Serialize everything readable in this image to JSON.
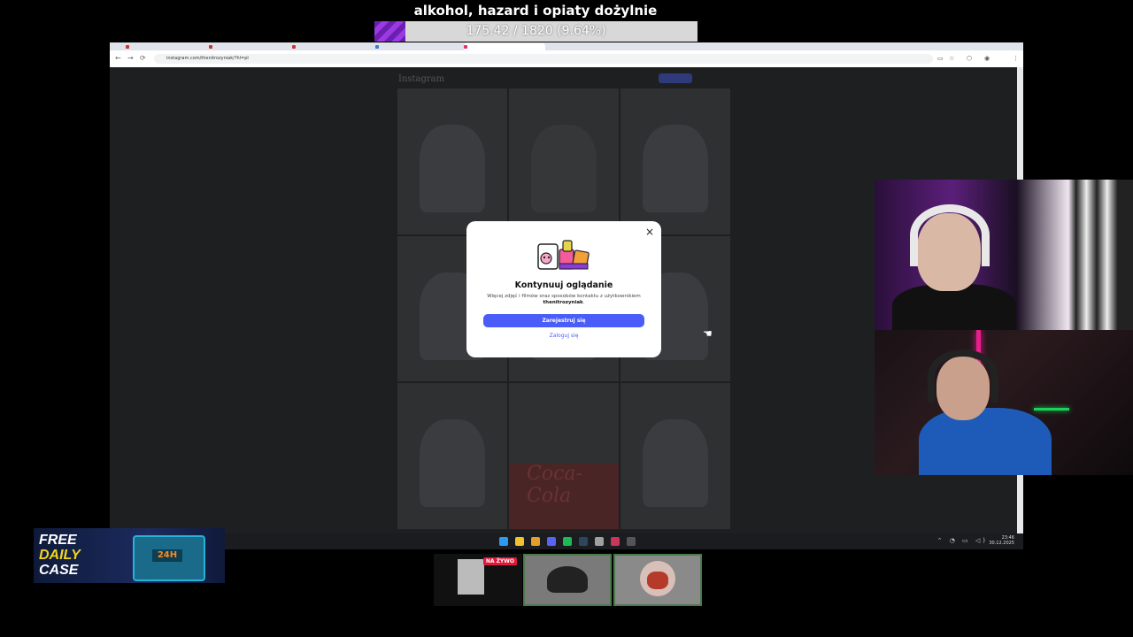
{
  "stream_goal": {
    "title": "alkohol, hazard i opiaty dożylnie",
    "progress_text": "175.42 / 1820 (9.64%)",
    "progress_fraction": 0.0964,
    "fill_color": "#7b2cbf"
  },
  "browser": {
    "url": "instagram.com/thenitrozyniak/?hl=pl",
    "tabs": [
      "",
      "",
      "",
      "",
      "",
      "",
      "",
      ""
    ],
    "nav": {
      "back": "←",
      "forward": "→",
      "reload": "⟳"
    }
  },
  "instagram": {
    "logo": "Instagram",
    "modal": {
      "title": "Kontynuuj oglądanie",
      "desc_before": "Więcej zdjęć i filmów oraz sposobów kontaktu z użytkownikiem",
      "username": "thenitrozyniak",
      "primary_button": "Zarejestruj się",
      "secondary_link": "Zaloguj się",
      "close": "×"
    },
    "grid_overlay_text": "Coca-Cola"
  },
  "taskbar": {
    "time": "23:46",
    "date": "30.12.2025",
    "tray": "⌃ ◔ ▭ ◁)",
    "icons": [
      {
        "name": "windows-start-icon",
        "color": "#2b9bf2"
      },
      {
        "name": "file-explorer-icon",
        "color": "#f2c12b"
      },
      {
        "name": "chrome-icon",
        "color": "#e0a02b"
      },
      {
        "name": "discord-icon",
        "color": "#5865f2"
      },
      {
        "name": "spotify-icon",
        "color": "#1db954"
      },
      {
        "name": "steam-icon",
        "color": "#2a475e"
      },
      {
        "name": "obs-icon",
        "color": "#a0a0a0"
      },
      {
        "name": "app-icon",
        "color": "#c8375a"
      },
      {
        "name": "app2-icon",
        "color": "#555"
      }
    ]
  },
  "ad": {
    "line1": "FREE",
    "line2": "DAILY",
    "line3": "CASE",
    "badge": "24H",
    "accent": "#f2d51c"
  },
  "thumbnails": {
    "live_badge": "NA ŻYWO"
  }
}
